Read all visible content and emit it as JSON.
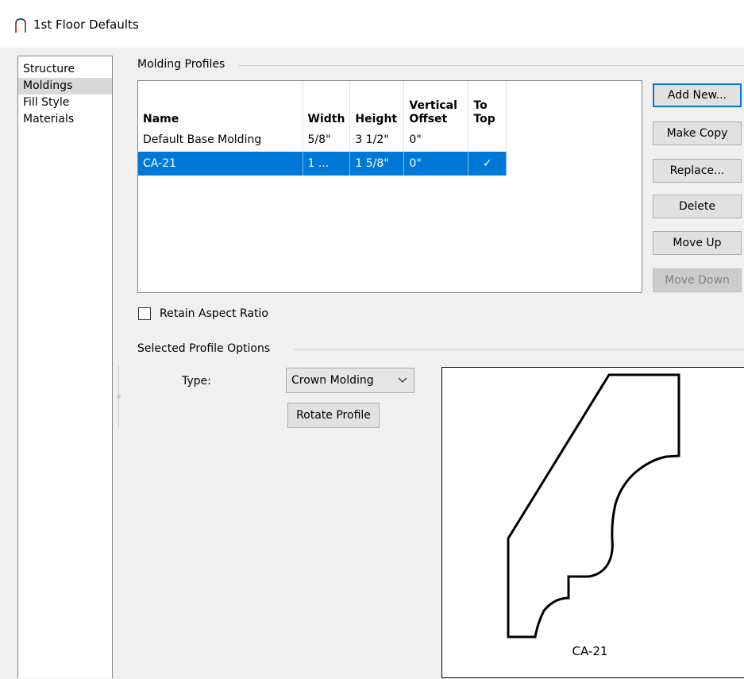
{
  "window": {
    "title": "1st Floor Defaults",
    "icon": "arch-icon"
  },
  "sidebar": {
    "items": [
      {
        "label": "Structure"
      },
      {
        "label": "Moldings",
        "selected": true
      },
      {
        "label": "Fill Style"
      },
      {
        "label": "Materials"
      }
    ]
  },
  "molding_profiles": {
    "group_title": "Molding Profiles",
    "columns": {
      "name": "Name",
      "width": "Width",
      "height": "Height",
      "vertical_offset_1": "Vertical",
      "vertical_offset_2": "Offset",
      "to_top_1": "To",
      "to_top_2": "Top"
    },
    "rows": [
      {
        "name": "Default Base Molding",
        "width": "5/8\"",
        "height": "3 1/2\"",
        "offset": "0\"",
        "to_top": ""
      },
      {
        "name": "CA-21",
        "width": "1 ...",
        "height": "1 5/8\"",
        "offset": "0\"",
        "to_top": "✓",
        "selected": true
      }
    ],
    "buttons": {
      "add_new": "Add New...",
      "make_copy": "Make Copy",
      "replace": "Replace...",
      "delete": "Delete",
      "move_up": "Move Up",
      "move_down": "Move Down"
    },
    "retain_aspect_ratio": {
      "label": "Retain Aspect Ratio",
      "checked": false
    }
  },
  "selected_profile_options": {
    "group_title": "Selected Profile Options",
    "type_label": "Type:",
    "type_value": "Crown Molding",
    "rotate_button": "Rotate Profile",
    "preview_label": "CA-21"
  },
  "colors": {
    "selection": "#0078d7",
    "background": "#f0f0f0",
    "default_button_border": "#0078d7"
  }
}
